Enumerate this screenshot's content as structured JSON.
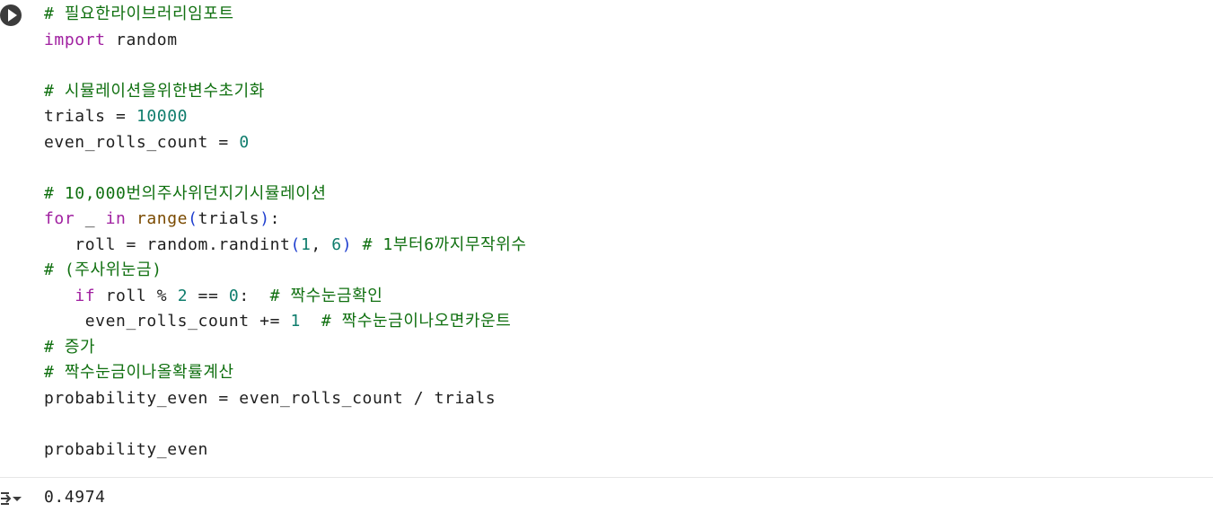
{
  "cell": {
    "run_button_icon": "play-circle-icon",
    "output_toggle_icon": "output-collapse-icon",
    "lines": [
      [
        {
          "t": "# 필요한라이브러리임포트",
          "c": "comment"
        }
      ],
      [
        {
          "t": "import",
          "c": "kw"
        },
        {
          "t": " random",
          "c": ""
        }
      ],
      [],
      [
        {
          "t": "# 시뮬레이션을위한변수초기화",
          "c": "comment"
        }
      ],
      [
        {
          "t": "trials = ",
          "c": ""
        },
        {
          "t": "10000",
          "c": "num"
        }
      ],
      [
        {
          "t": "even_rolls_count = ",
          "c": ""
        },
        {
          "t": "0",
          "c": "num"
        }
      ],
      [],
      [
        {
          "t": "# 10,000번의주사위던지기시뮬레이션",
          "c": "comment"
        }
      ],
      [
        {
          "t": "for",
          "c": "kw"
        },
        {
          "t": " _ ",
          "c": ""
        },
        {
          "t": "in",
          "c": "kw"
        },
        {
          "t": " ",
          "c": ""
        },
        {
          "t": "range",
          "c": "builtin"
        },
        {
          "t": "(",
          "c": "paren"
        },
        {
          "t": "trials",
          "c": ""
        },
        {
          "t": ")",
          "c": "paren"
        },
        {
          "t": ":",
          "c": ""
        }
      ],
      [
        {
          "t": "   roll = random.randint",
          "c": ""
        },
        {
          "t": "(",
          "c": "paren"
        },
        {
          "t": "1",
          "c": "num"
        },
        {
          "t": ", ",
          "c": ""
        },
        {
          "t": "6",
          "c": "num"
        },
        {
          "t": ")",
          "c": "paren"
        },
        {
          "t": " ",
          "c": ""
        },
        {
          "t": "# 1부터6까지무작위수",
          "c": "comment"
        }
      ],
      [
        {
          "t": "# (주사위눈금)",
          "c": "comment"
        }
      ],
      [
        {
          "t": "   ",
          "c": ""
        },
        {
          "t": "if",
          "c": "kw"
        },
        {
          "t": " roll % ",
          "c": ""
        },
        {
          "t": "2",
          "c": "num"
        },
        {
          "t": " == ",
          "c": ""
        },
        {
          "t": "0",
          "c": "num"
        },
        {
          "t": ":  ",
          "c": ""
        },
        {
          "t": "# 짝수눈금확인",
          "c": "comment"
        }
      ],
      [
        {
          "t": "    even_rolls_count += ",
          "c": ""
        },
        {
          "t": "1",
          "c": "num"
        },
        {
          "t": "  ",
          "c": ""
        },
        {
          "t": "# 짝수눈금이나오면카운트",
          "c": "comment"
        }
      ],
      [
        {
          "t": "# 증가",
          "c": "comment"
        }
      ],
      [
        {
          "t": "# 짝수눈금이나올확률계산",
          "c": "comment"
        }
      ],
      [
        {
          "t": "probability_even = even_rolls_count / trials",
          "c": ""
        }
      ],
      [],
      [
        {
          "t": "probability_even",
          "c": ""
        }
      ]
    ],
    "output": "0.4974"
  }
}
